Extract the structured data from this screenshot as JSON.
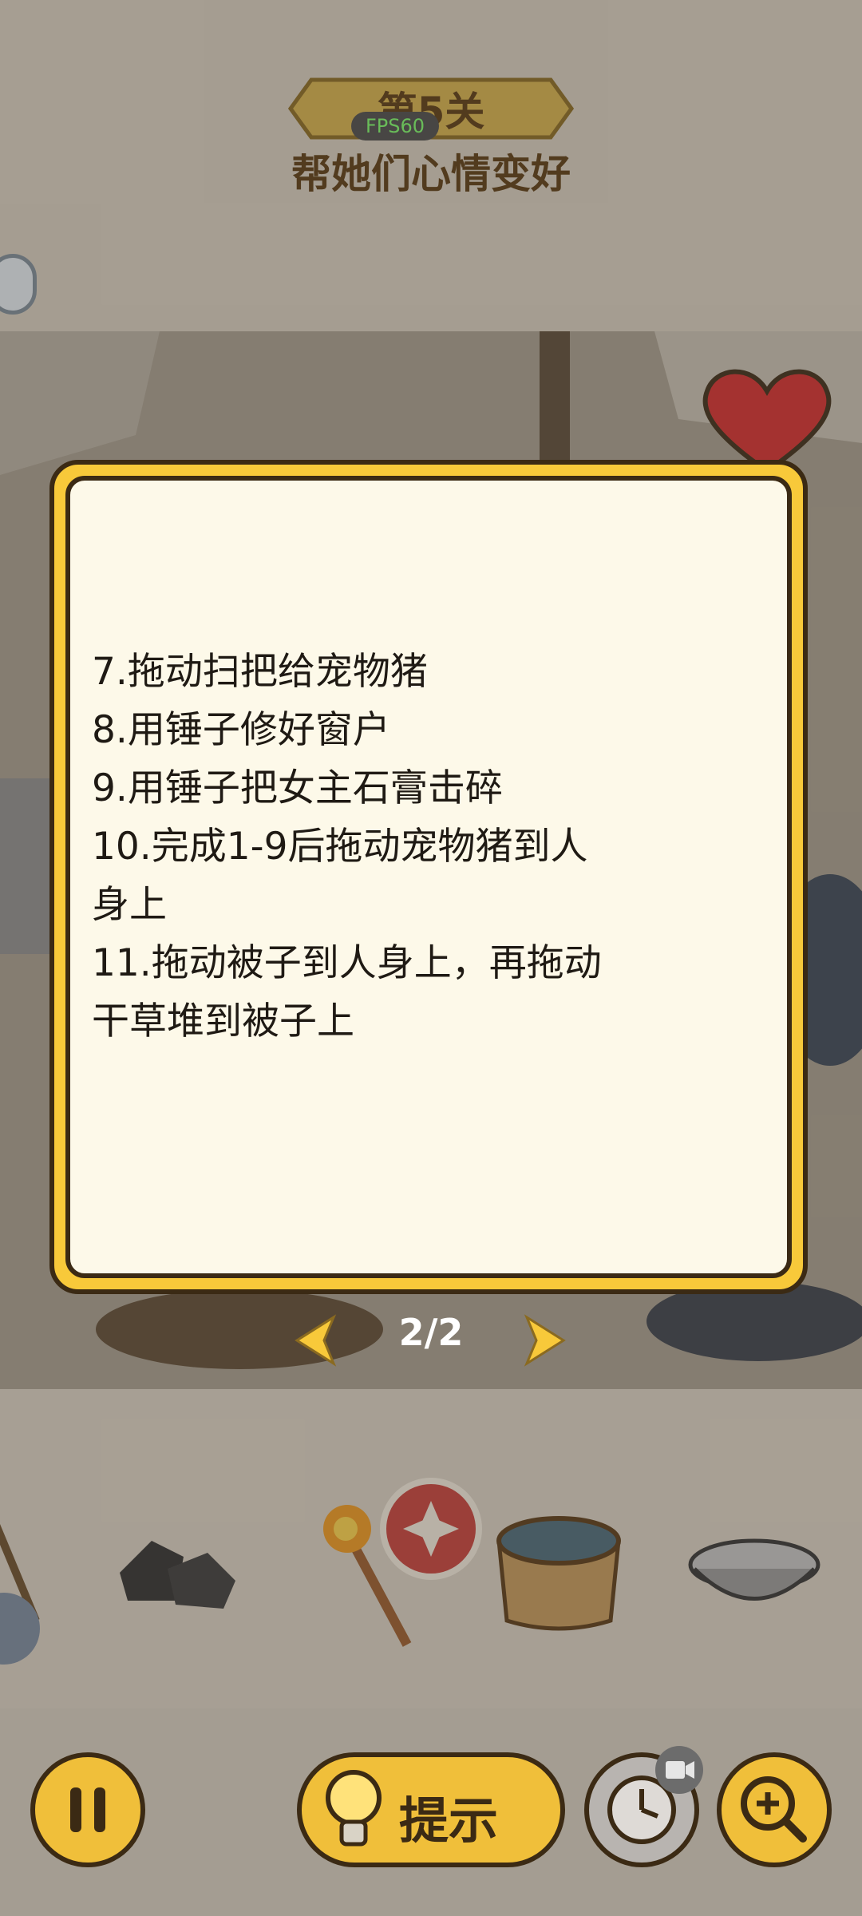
{
  "header": {
    "level_title": "第5关",
    "fps": "FPS60",
    "goal": "帮她们心情变好"
  },
  "dialog": {
    "tips": [
      "7.拖动扫把给宠物猪",
      "8.用锤子修好窗户",
      "9.用锤子把女主石膏击碎",
      "10.完成1-9后拖动宠物猪到人\n身上",
      "11.拖动被子到人身上，再拖动\n干草堆到被子上"
    ],
    "page_indicator": "2/2"
  },
  "bottom_bar": {
    "hint_label": "提示"
  },
  "items": [
    "broom-icon",
    "coal-icon",
    "torch-icon",
    "water-tub-icon",
    "metal-bowl-icon"
  ],
  "colors": {
    "accent_yellow": "#f0bf3a",
    "dialog_bg": "#fdf9e9",
    "outline": "#3b2a14",
    "heart_red": "#d72c2c"
  }
}
